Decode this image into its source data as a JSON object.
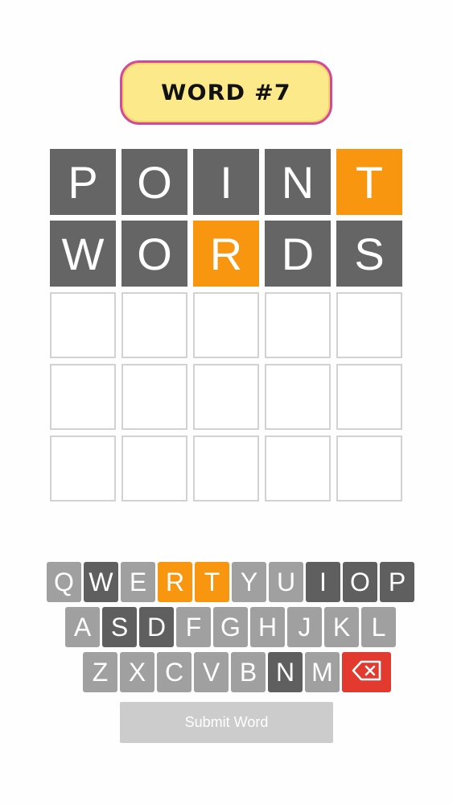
{
  "header": {
    "title": "WORD #7"
  },
  "board": {
    "rows": [
      [
        {
          "letter": "P",
          "state": "absent"
        },
        {
          "letter": "O",
          "state": "absent"
        },
        {
          "letter": "I",
          "state": "absent"
        },
        {
          "letter": "N",
          "state": "absent"
        },
        {
          "letter": "T",
          "state": "present"
        }
      ],
      [
        {
          "letter": "W",
          "state": "absent"
        },
        {
          "letter": "O",
          "state": "absent"
        },
        {
          "letter": "R",
          "state": "present"
        },
        {
          "letter": "D",
          "state": "absent"
        },
        {
          "letter": "S",
          "state": "absent"
        }
      ],
      [
        {
          "letter": "",
          "state": "empty"
        },
        {
          "letter": "",
          "state": "empty"
        },
        {
          "letter": "",
          "state": "empty"
        },
        {
          "letter": "",
          "state": "empty"
        },
        {
          "letter": "",
          "state": "empty"
        }
      ],
      [
        {
          "letter": "",
          "state": "empty"
        },
        {
          "letter": "",
          "state": "empty"
        },
        {
          "letter": "",
          "state": "empty"
        },
        {
          "letter": "",
          "state": "empty"
        },
        {
          "letter": "",
          "state": "empty"
        }
      ],
      [
        {
          "letter": "",
          "state": "empty"
        },
        {
          "letter": "",
          "state": "empty"
        },
        {
          "letter": "",
          "state": "empty"
        },
        {
          "letter": "",
          "state": "empty"
        },
        {
          "letter": "",
          "state": "empty"
        }
      ]
    ]
  },
  "keyboard": {
    "rows": [
      [
        {
          "key": "Q",
          "state": "unused"
        },
        {
          "key": "W",
          "state": "absent"
        },
        {
          "key": "E",
          "state": "unused"
        },
        {
          "key": "R",
          "state": "present"
        },
        {
          "key": "T",
          "state": "present"
        },
        {
          "key": "Y",
          "state": "unused"
        },
        {
          "key": "U",
          "state": "unused"
        },
        {
          "key": "I",
          "state": "absent"
        },
        {
          "key": "O",
          "state": "absent"
        },
        {
          "key": "P",
          "state": "absent"
        }
      ],
      [
        {
          "key": "A",
          "state": "unused"
        },
        {
          "key": "S",
          "state": "absent"
        },
        {
          "key": "D",
          "state": "absent"
        },
        {
          "key": "F",
          "state": "unused"
        },
        {
          "key": "G",
          "state": "unused"
        },
        {
          "key": "H",
          "state": "unused"
        },
        {
          "key": "J",
          "state": "unused"
        },
        {
          "key": "K",
          "state": "unused"
        },
        {
          "key": "L",
          "state": "unused"
        }
      ],
      [
        {
          "key": "Z",
          "state": "unused"
        },
        {
          "key": "X",
          "state": "unused"
        },
        {
          "key": "C",
          "state": "unused"
        },
        {
          "key": "V",
          "state": "unused"
        },
        {
          "key": "B",
          "state": "unused"
        },
        {
          "key": "N",
          "state": "absent"
        },
        {
          "key": "M",
          "state": "unused"
        },
        {
          "key": "",
          "state": "backspace",
          "icon": "backspace-icon"
        }
      ]
    ],
    "submit_label": "Submit Word"
  },
  "colors": {
    "absent": "#656565",
    "present": "#f9960f",
    "unused": "#a0a0a0",
    "backspace": "#e23a2e",
    "title_bg": "#fbe98a",
    "title_border": "#d14a9a"
  }
}
